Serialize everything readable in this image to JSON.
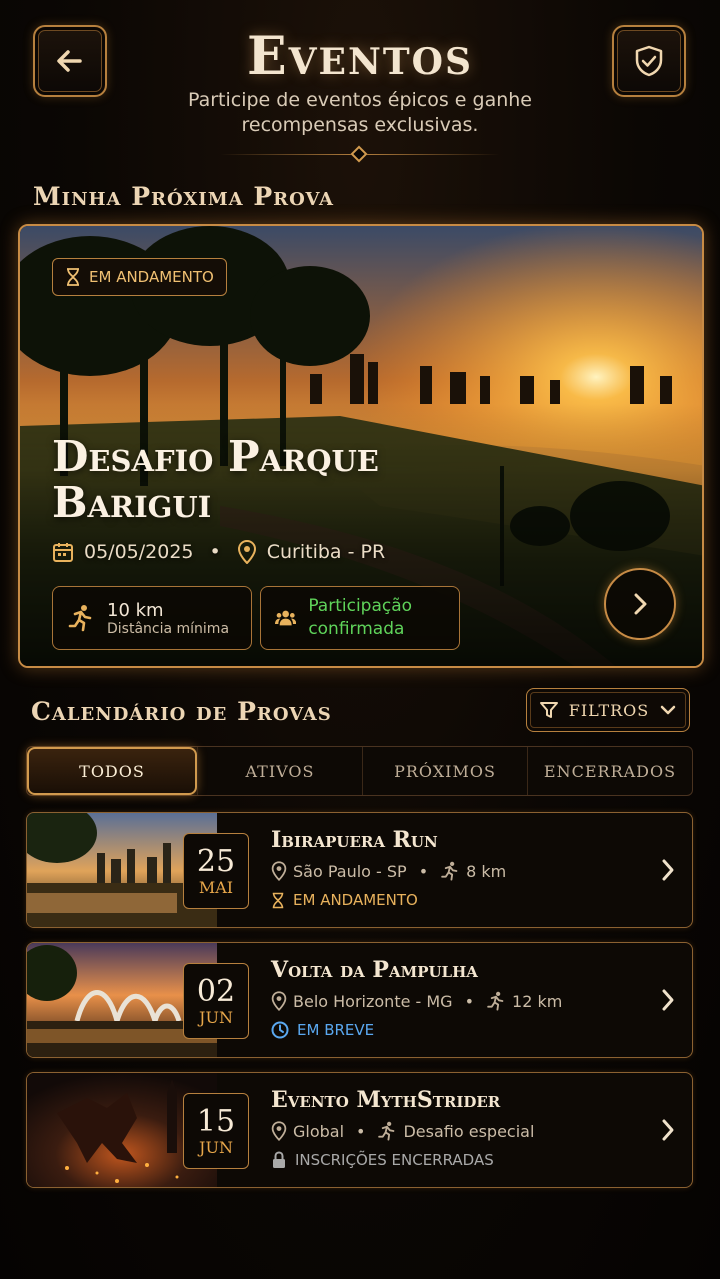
{
  "header": {
    "title": "Eventos",
    "subtitle": "Participe de eventos épicos e ganhe recompensas exclusivas.",
    "back_icon": "arrow-left-icon",
    "shield_icon": "shield-check-icon"
  },
  "next_race": {
    "section_title": "Minha Próxima Prova",
    "status": "EM ANDAMENTO",
    "title": "Desafio Parque Barigui",
    "date": "05/05/2025",
    "location": "Curitiba - PR",
    "distance": "10 km",
    "distance_label": "Distância mínima",
    "participation": "Participação confirmada"
  },
  "calendar": {
    "section_title": "Calendário de Provas",
    "filter_label": "FILTROS",
    "tabs": [
      "TODOS",
      "ATIVOS",
      "PRÓXIMOS",
      "ENCERRADOS"
    ],
    "active_tab": "TODOS"
  },
  "events": [
    {
      "day": "25",
      "month": "MAI",
      "title": "Ibirapuera Run",
      "location": "São Paulo - SP",
      "detail": "8 km",
      "status": "EM ANDAMENTO",
      "status_color": "#e8b25d"
    },
    {
      "day": "02",
      "month": "JUN",
      "title": "Volta da Pampulha",
      "location": "Belo Horizonte - MG",
      "detail": "12 km",
      "status": "EM BREVE",
      "status_color": "#5aa8f0"
    },
    {
      "day": "15",
      "month": "JUN",
      "title": "Evento MythStrider",
      "location": "Global",
      "detail": "Desafio especial",
      "status": "INSCRIÇÕES ENCERRADAS",
      "status_color": "#a9a9a9"
    }
  ]
}
